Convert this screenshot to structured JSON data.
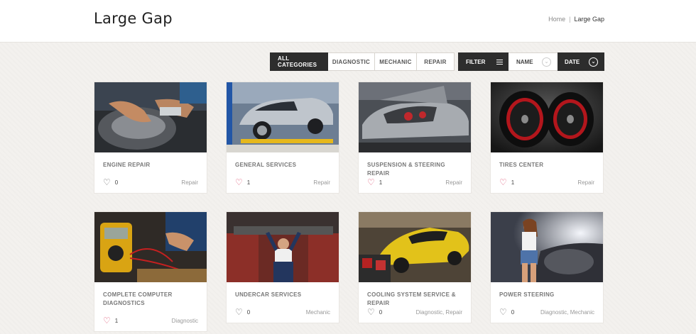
{
  "header": {
    "title": "Large Gap",
    "breadcrumb": {
      "home": "Home",
      "separator": "|",
      "current": "Large Gap"
    }
  },
  "filters": {
    "categories": [
      {
        "label": "ALL CATEGORIES",
        "active": true
      },
      {
        "label": "DIAGNOSTIC",
        "active": false
      },
      {
        "label": "MECHANIC",
        "active": false
      },
      {
        "label": "REPAIR",
        "active": false
      }
    ],
    "filter_label": "FILTER",
    "sort_name_label": "NAME",
    "sort_date_label": "DATE"
  },
  "cards": [
    {
      "title": "ENGINE REPAIR",
      "likes": "0",
      "liked": false,
      "categories": "Repair",
      "image": "engine-repair-photo"
    },
    {
      "title": "GENERAL SERVICES",
      "likes": "1",
      "liked": true,
      "categories": "Repair",
      "image": "car-on-lift-photo"
    },
    {
      "title": "SUSPENSION & STEERING REPAIR",
      "likes": "1",
      "liked": true,
      "categories": "Repair",
      "image": "open-hood-car-photo"
    },
    {
      "title": "TIRES CENTER",
      "likes": "1",
      "liked": true,
      "categories": "Repair",
      "image": "red-rim-tires-photo"
    },
    {
      "title": "COMPLETE COMPUTER DIAGNOSTICS",
      "likes": "1",
      "liked": true,
      "categories": "Diagnostic",
      "image": "multimeter-photo"
    },
    {
      "title": "UNDERCAR SERVICES",
      "likes": "0",
      "liked": false,
      "categories": "Mechanic",
      "image": "mechanic-under-car-photo"
    },
    {
      "title": "COOLING SYSTEM SERVICE & REPAIR",
      "likes": "0",
      "liked": false,
      "categories": "Diagnostic, Repair",
      "image": "yellow-sports-car-photo"
    },
    {
      "title": "POWER STEERING",
      "likes": "0",
      "liked": false,
      "categories": "Diagnostic, Mechanic",
      "image": "woman-engine-photo"
    }
  ],
  "colors": {
    "dark": "#2d2d2d",
    "heart_liked": "#e0607e",
    "background": "#f3f1ee"
  }
}
